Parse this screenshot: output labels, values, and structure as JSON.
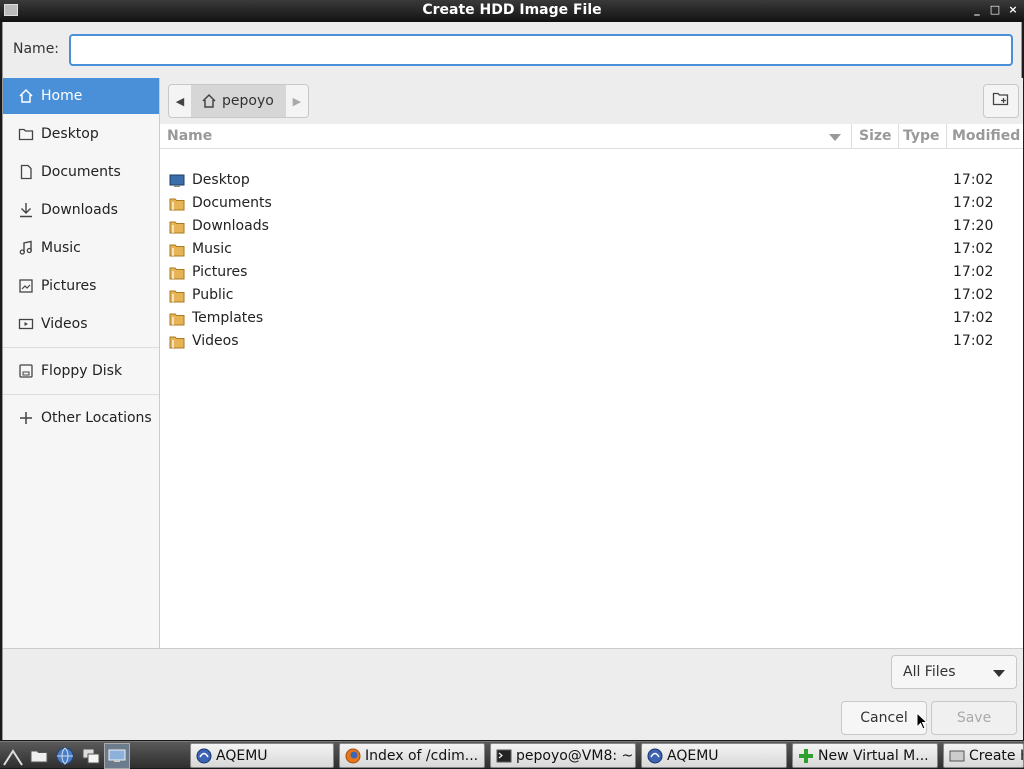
{
  "window": {
    "title": "Create HDD Image File",
    "controls": [
      "_",
      "□",
      "×"
    ]
  },
  "name_field": {
    "label": "Name:",
    "value": "",
    "placeholder": ""
  },
  "sidebar": {
    "items": [
      {
        "label": "Home",
        "icon": "home-icon",
        "active": true
      },
      {
        "label": "Desktop",
        "icon": "folder-icon"
      },
      {
        "label": "Documents",
        "icon": "document-icon"
      },
      {
        "label": "Downloads",
        "icon": "download-icon"
      },
      {
        "label": "Music",
        "icon": "music-note-icon"
      },
      {
        "label": "Pictures",
        "icon": "image-icon"
      },
      {
        "label": "Videos",
        "icon": "video-icon"
      },
      {
        "label": "Floppy Disk",
        "icon": "drive-icon"
      },
      {
        "label": "Other Locations",
        "icon": "plus-icon"
      }
    ]
  },
  "path_bar": {
    "current": "pepoyo"
  },
  "file_list": {
    "columns": {
      "name": "Name",
      "size": "Size",
      "type": "Type",
      "modified": "Modified"
    },
    "rows": [
      {
        "name": "Desktop",
        "modified": "17:02",
        "icon": "desktop-folder-icon"
      },
      {
        "name": "Documents",
        "modified": "17:02",
        "icon": "folder-icon"
      },
      {
        "name": "Downloads",
        "modified": "17:20",
        "icon": "folder-icon"
      },
      {
        "name": "Music",
        "modified": "17:02",
        "icon": "folder-icon"
      },
      {
        "name": "Pictures",
        "modified": "17:02",
        "icon": "folder-icon"
      },
      {
        "name": "Public",
        "modified": "17:02",
        "icon": "folder-icon"
      },
      {
        "name": "Templates",
        "modified": "17:02",
        "icon": "folder-icon"
      },
      {
        "name": "Videos",
        "modified": "17:02",
        "icon": "folder-icon"
      }
    ]
  },
  "filter": {
    "selected": "All Files"
  },
  "buttons": {
    "cancel": "Cancel",
    "save": "Save"
  },
  "taskbar": {
    "tasks": [
      {
        "label": "AQEMU",
        "icon": "aqemu-icon"
      },
      {
        "label": "Index of /cdim...",
        "icon": "firefox-icon"
      },
      {
        "label": "pepoyo@VM8: ~",
        "icon": "terminal-icon"
      },
      {
        "label": "AQEMU",
        "icon": "aqemu-icon"
      },
      {
        "label": "New Virtual M...",
        "icon": "green-plus-icon"
      },
      {
        "label": "Create H",
        "icon": "disk-icon"
      }
    ]
  },
  "colors": {
    "accent": "#4a90d9",
    "titlebar": "#1e1e1e",
    "folder": "#e6b455"
  }
}
